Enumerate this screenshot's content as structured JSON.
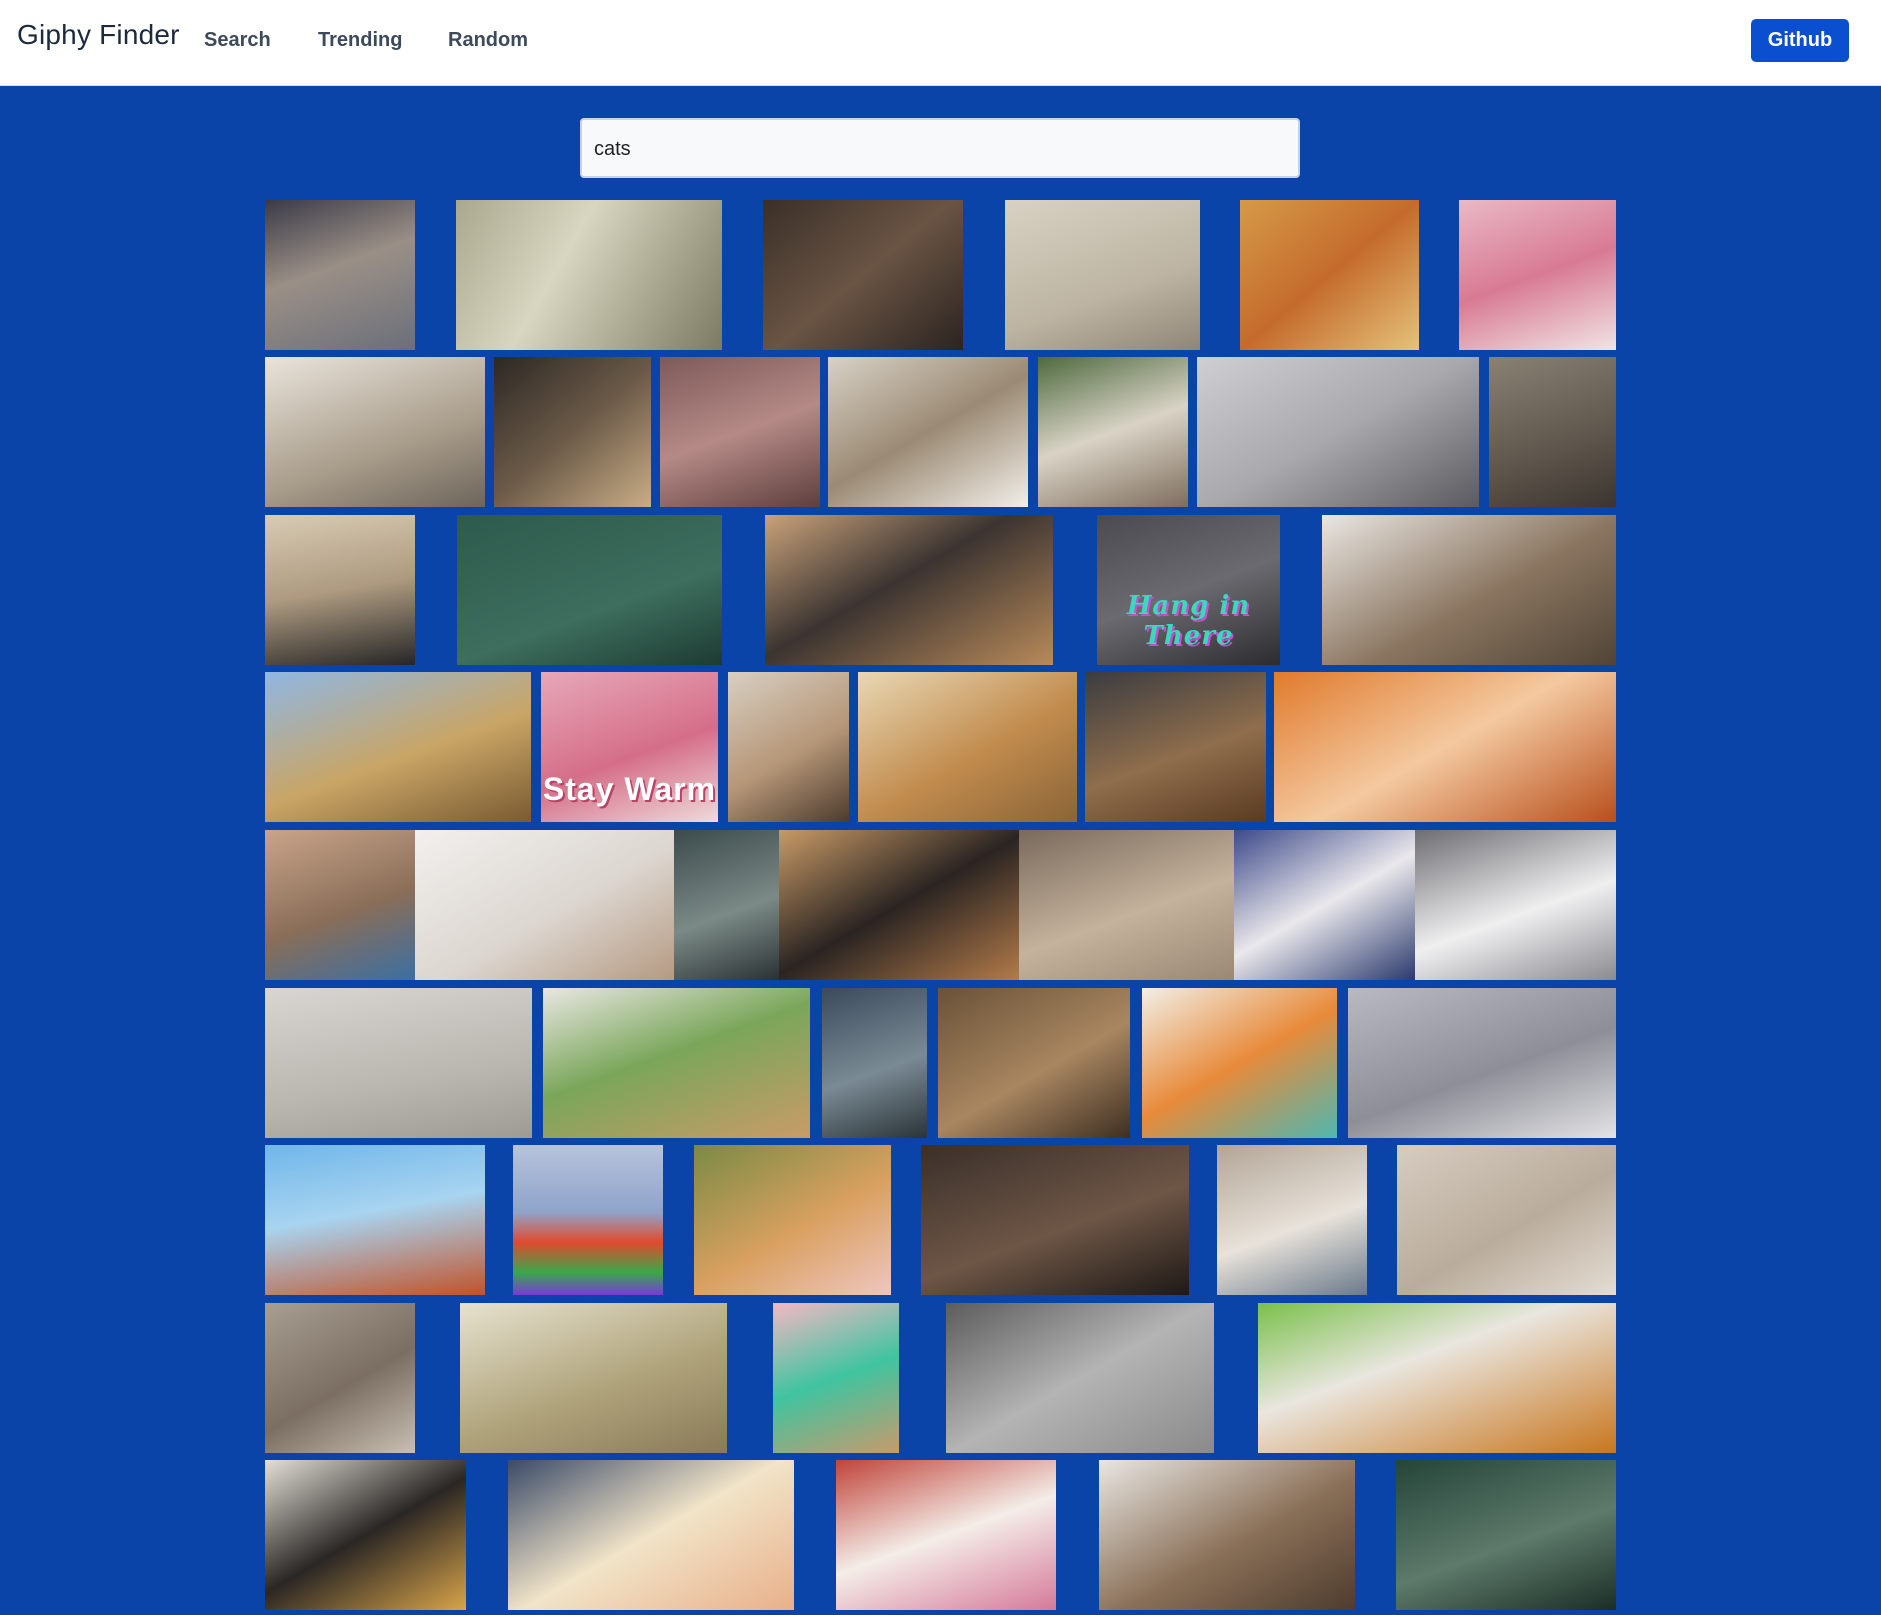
{
  "header": {
    "brand": "Giphy Finder",
    "nav": [
      {
        "label": "Search"
      },
      {
        "label": "Trending"
      },
      {
        "label": "Random"
      }
    ],
    "github_label": "Github"
  },
  "search": {
    "value": "cats"
  },
  "gif_rows": [
    [
      {
        "bg": "linear-gradient(160deg,#3a3a48,#9a8f86 45%,#6b6f7a)"
      },
      {
        "bg": "linear-gradient(120deg,#a9a78d,#d8d6c0 40%,#7d7a63)"
      },
      {
        "bg": "linear-gradient(140deg,#3a2f28,#6a5444 50%,#2b2420)"
      },
      {
        "bg": "linear-gradient(160deg,#d8d2c4,#bdb4a2 60%,#8f8678)"
      },
      {
        "bg": "linear-gradient(140deg,#d59a48,#c46b2c 50%,#e5c27a)"
      },
      {
        "bg": "linear-gradient(160deg,#e9b9c6,#d87a93 50%,#f1e4e4)"
      }
    ],
    [
      {
        "bg": "linear-gradient(160deg,#e9e4dc,#a89c8a 60%,#6d655b)"
      },
      {
        "bg": "linear-gradient(140deg,#2c2824,#6b5a48 50%,#c9ad86)"
      },
      {
        "bg": "linear-gradient(160deg,#7d5a58,#b58a86 50%,#5e3f3d)"
      },
      {
        "bg": "linear-gradient(150deg,#d7d1c6,#9b8a74 50%,#f2efe8)"
      },
      {
        "bg": "linear-gradient(160deg,#4e6a3e,#d9d3c6 50%,#7e6d5d)"
      },
      {
        "bg": "linear-gradient(150deg,#cfcfd2,#a9a9ad 50%,#5a5a60)"
      },
      {
        "bg": "linear-gradient(160deg,#8a8174,#5e564c 60%,#3b352f)"
      }
    ],
    [
      {
        "bg": "linear-gradient(170deg,#d9cbb4,#ad9a80 50%,#262626)"
      },
      {
        "bg": "linear-gradient(160deg,#2d5a4c,#3d6e5e 60%,#1d3b32)"
      },
      {
        "bg": "linear-gradient(150deg,#c9a27a,#3b3431 45%,#b88a5a)"
      },
      {
        "bg": "linear-gradient(160deg,#4a4a50,#6a6a70 50%,#2c2c30)",
        "label": "Hang in There"
      },
      {
        "bg": "linear-gradient(150deg,#e9e6e2,#8a7560 55%,#514436)"
      }
    ],
    [
      {
        "bg": "linear-gradient(160deg,#8fb7e4,#c9a565 55%,#7a5a32)"
      },
      {
        "bg": "linear-gradient(160deg,#e6a8b9,#d56e88 55%,#efdada)",
        "label": "Stay Warm"
      },
      {
        "bg": "linear-gradient(150deg,#d8cfc2,#b59677 55%,#4d3b2d)"
      },
      {
        "bg": "linear-gradient(150deg,#e8d8b4,#c18b4d 55%,#8a6437)"
      },
      {
        "bg": "linear-gradient(160deg,#3b3c41,#8f6e4c 55%,#5a3a22)"
      },
      {
        "bg": "linear-gradient(150deg,#e07a2c,#f4c9a0 50%,#b84f1c)"
      }
    ],
    [
      {
        "bg": "linear-gradient(160deg,#c9a48a,#8a6e58 55%,#3c6fa3)"
      },
      {
        "bg": "linear-gradient(150deg,#f2f0ee,#dcd6d0 55%,#b49a82)"
      },
      {
        "bg": "linear-gradient(160deg,#3b4a4c,#7b8a86 55%,#2a3234)"
      },
      {
        "bg": "linear-gradient(150deg,#c89a66,#2a2422 50%,#b37b4a)"
      },
      {
        "bg": "linear-gradient(160deg,#7a6a5c,#c4b29c 55%,#9b8874)"
      },
      {
        "bg": "linear-gradient(150deg,#3d4a8a,#eae8ec 50%,#2b3a6e)"
      },
      {
        "bg": "linear-gradient(160deg,#6d6d72,#f0eff0 55%,#8a8a90)"
      }
    ],
    [
      {
        "bg": "linear-gradient(170deg,#d8d6d2,#bab6b0 60%,#9e9a94)"
      },
      {
        "bg": "linear-gradient(160deg,#e9e7e3,#7aa65a 45%,#c99b68)"
      },
      {
        "bg": "linear-gradient(160deg,#3b4a5c,#7a8a94 55%,#2a3438)"
      },
      {
        "bg": "linear-gradient(150deg,#6a5238,#a88660 55%,#3e2f22)"
      },
      {
        "bg": "linear-gradient(150deg,#f2efe6,#e88a3a 50%,#4fb7b0)"
      },
      {
        "bg": "linear-gradient(160deg,#b8b9c2,#8d8e97 55%,#e3e3e6)"
      }
    ],
    [
      {
        "bg": "linear-gradient(170deg,#6fb6ea,#a8d4f0 45%,#c0532a)"
      },
      {
        "bg": "linear-gradient(180deg,#b7c3dc,#8fa3c9 45%,#e04a2e 65%,#3aa84a 85%,#7a3ad8)"
      },
      {
        "bg": "linear-gradient(150deg,#7a8a44,#d9a060 55%,#efc6c0)"
      },
      {
        "bg": "linear-gradient(160deg,#3a2f2a,#6e5646 55%,#1e1916)"
      },
      {
        "bg": "linear-gradient(160deg,#b2a596,#e8e2da 55%,#6a7a8a)"
      },
      {
        "bg": "linear-gradient(150deg,#d6ccc0,#b9ac9c 55%,#e5ddd3)"
      }
    ],
    [
      {
        "bg": "linear-gradient(150deg,#a89e92,#7b6e62 55%,#c9bfb3)"
      },
      {
        "bg": "linear-gradient(160deg,#e6e2cf,#b0a47c 55%,#8a7a58)"
      },
      {
        "bg": "linear-gradient(160deg,#f4b8c4,#3fc4a0 50%,#c79a6c)"
      },
      {
        "bg": "linear-gradient(150deg,#5c5c5c,#b4b4b4 50%,#8a8a8a)"
      },
      {
        "bg": "linear-gradient(160deg,#7ac04a,#e9e6df 40%,#c8761e)"
      }
    ],
    [
      {
        "bg": "linear-gradient(150deg,#e4e0d8,#2a2624 50%,#d8a44a)"
      },
      {
        "bg": "linear-gradient(150deg,#3a4a68,#f1e4c8 50%,#e8b08a)"
      },
      {
        "bg": "linear-gradient(160deg,#c0443a,#f4ede8 50%,#d57a9a)"
      },
      {
        "bg": "linear-gradient(150deg,#e8e6e2,#8a7058 55%,#4e3c2e)"
      },
      {
        "bg": "linear-gradient(160deg,#25453a,#5d7a6a 55%,#1b2e26)"
      }
    ]
  ]
}
